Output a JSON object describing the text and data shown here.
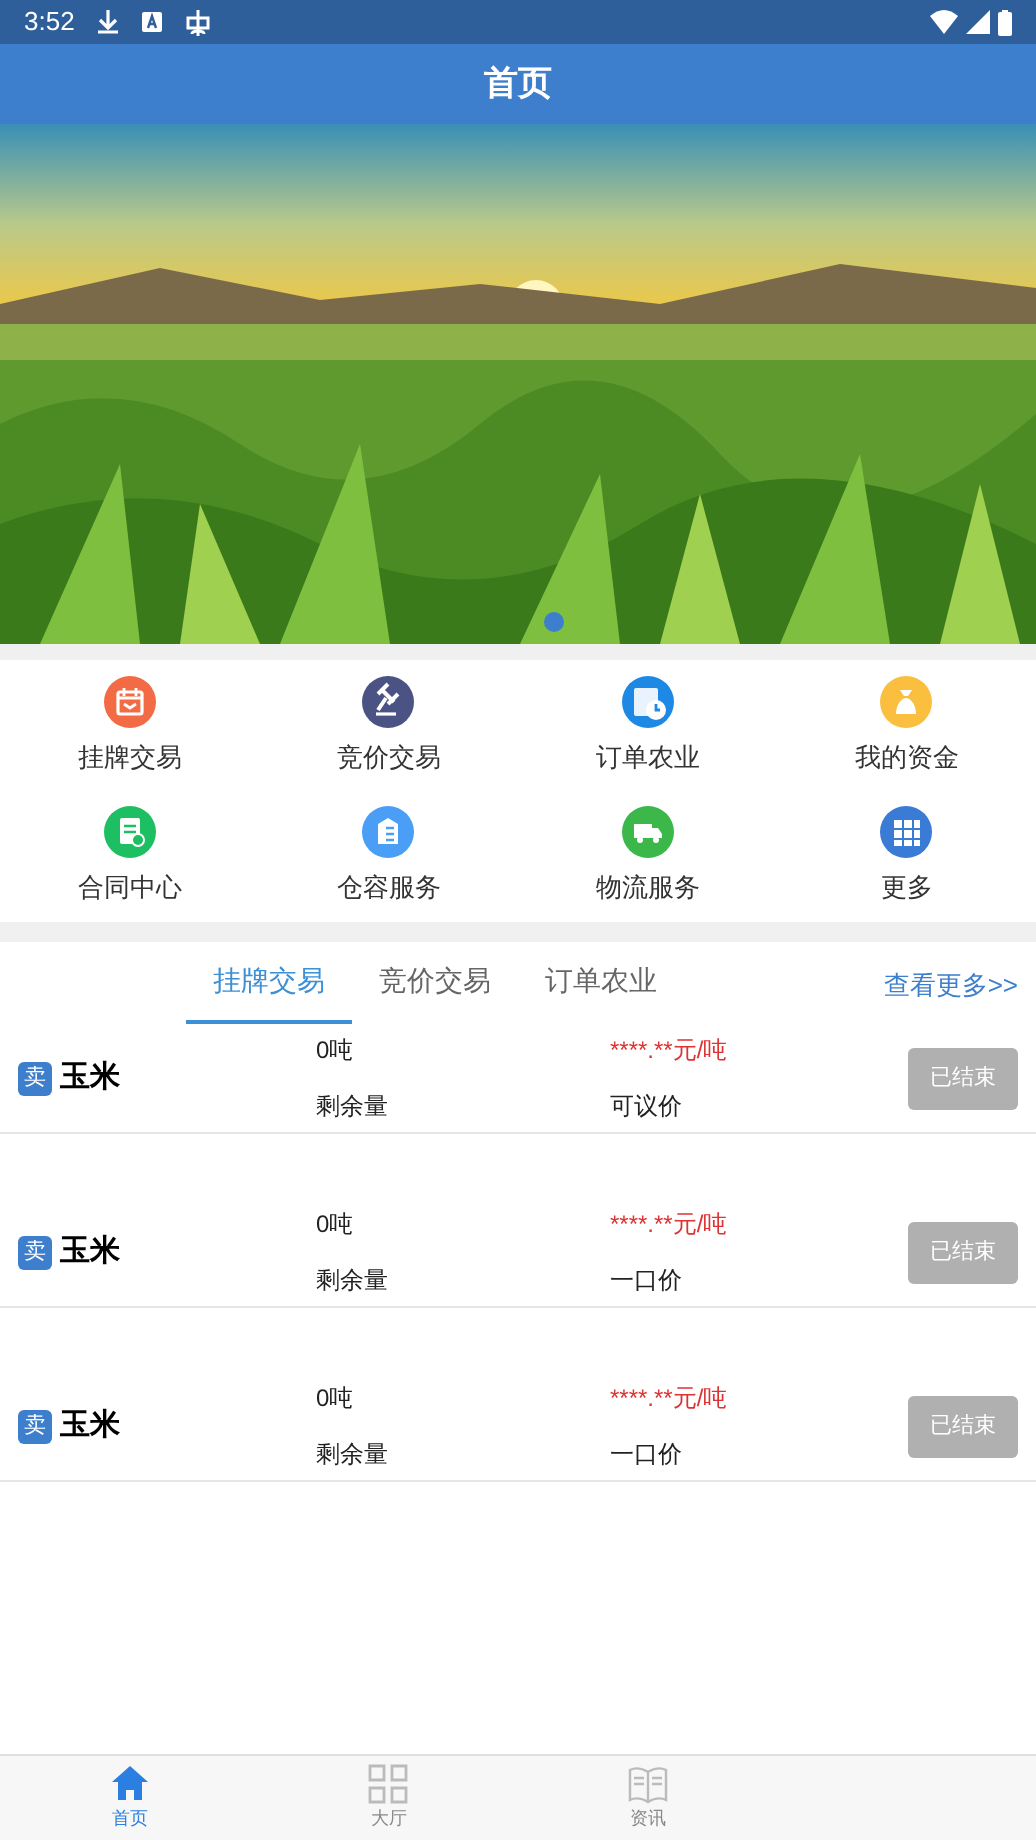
{
  "status_bar": {
    "time": "3:52"
  },
  "header": {
    "title": "首页"
  },
  "shortcuts": [
    {
      "label": "挂牌交易",
      "kind": "calendar",
      "color": "#f26b45"
    },
    {
      "label": "竞价交易",
      "kind": "gavel",
      "color": "#4a5384"
    },
    {
      "label": "订单农业",
      "kind": "clock",
      "color": "#1e88e5"
    },
    {
      "label": "我的资金",
      "kind": "moneybag",
      "color": "#fbbf3f"
    },
    {
      "label": "合同中心",
      "kind": "document",
      "color": "#1dbf62"
    },
    {
      "label": "仓容服务",
      "kind": "building",
      "color": "#4b9ef5"
    },
    {
      "label": "物流服务",
      "kind": "truck",
      "color": "#3cb84a"
    },
    {
      "label": "更多",
      "kind": "grid",
      "color": "#3a7bd5"
    }
  ],
  "tabs": [
    {
      "label": "挂牌交易",
      "selected": true
    },
    {
      "label": "竞价交易",
      "selected": false
    },
    {
      "label": "订单农业",
      "selected": false
    }
  ],
  "more_link": "查看更多>>",
  "listings": [
    {
      "badge": "卖",
      "name": "玉米",
      "quantity": "0吨",
      "quantity_label": "剩余量",
      "price": "****.**元/吨",
      "price_type": "可议价",
      "status": "已结束",
      "disabled": true
    },
    {
      "badge": "卖",
      "name": "玉米",
      "quantity": "0吨",
      "quantity_label": "剩余量",
      "price": "****.**元/吨",
      "price_type": "一口价",
      "status": "已结束",
      "disabled": true
    },
    {
      "badge": "卖",
      "name": "玉米",
      "quantity": "0吨",
      "quantity_label": "剩余量",
      "price": "****.**元/吨",
      "price_type": "一口价",
      "status": "已结束",
      "disabled": true
    }
  ],
  "bottom_nav": [
    {
      "label": "首页",
      "kind": "home",
      "selected": true
    },
    {
      "label": "大厅",
      "kind": "grid",
      "selected": false
    },
    {
      "label": "资讯",
      "kind": "book",
      "selected": false
    }
  ]
}
